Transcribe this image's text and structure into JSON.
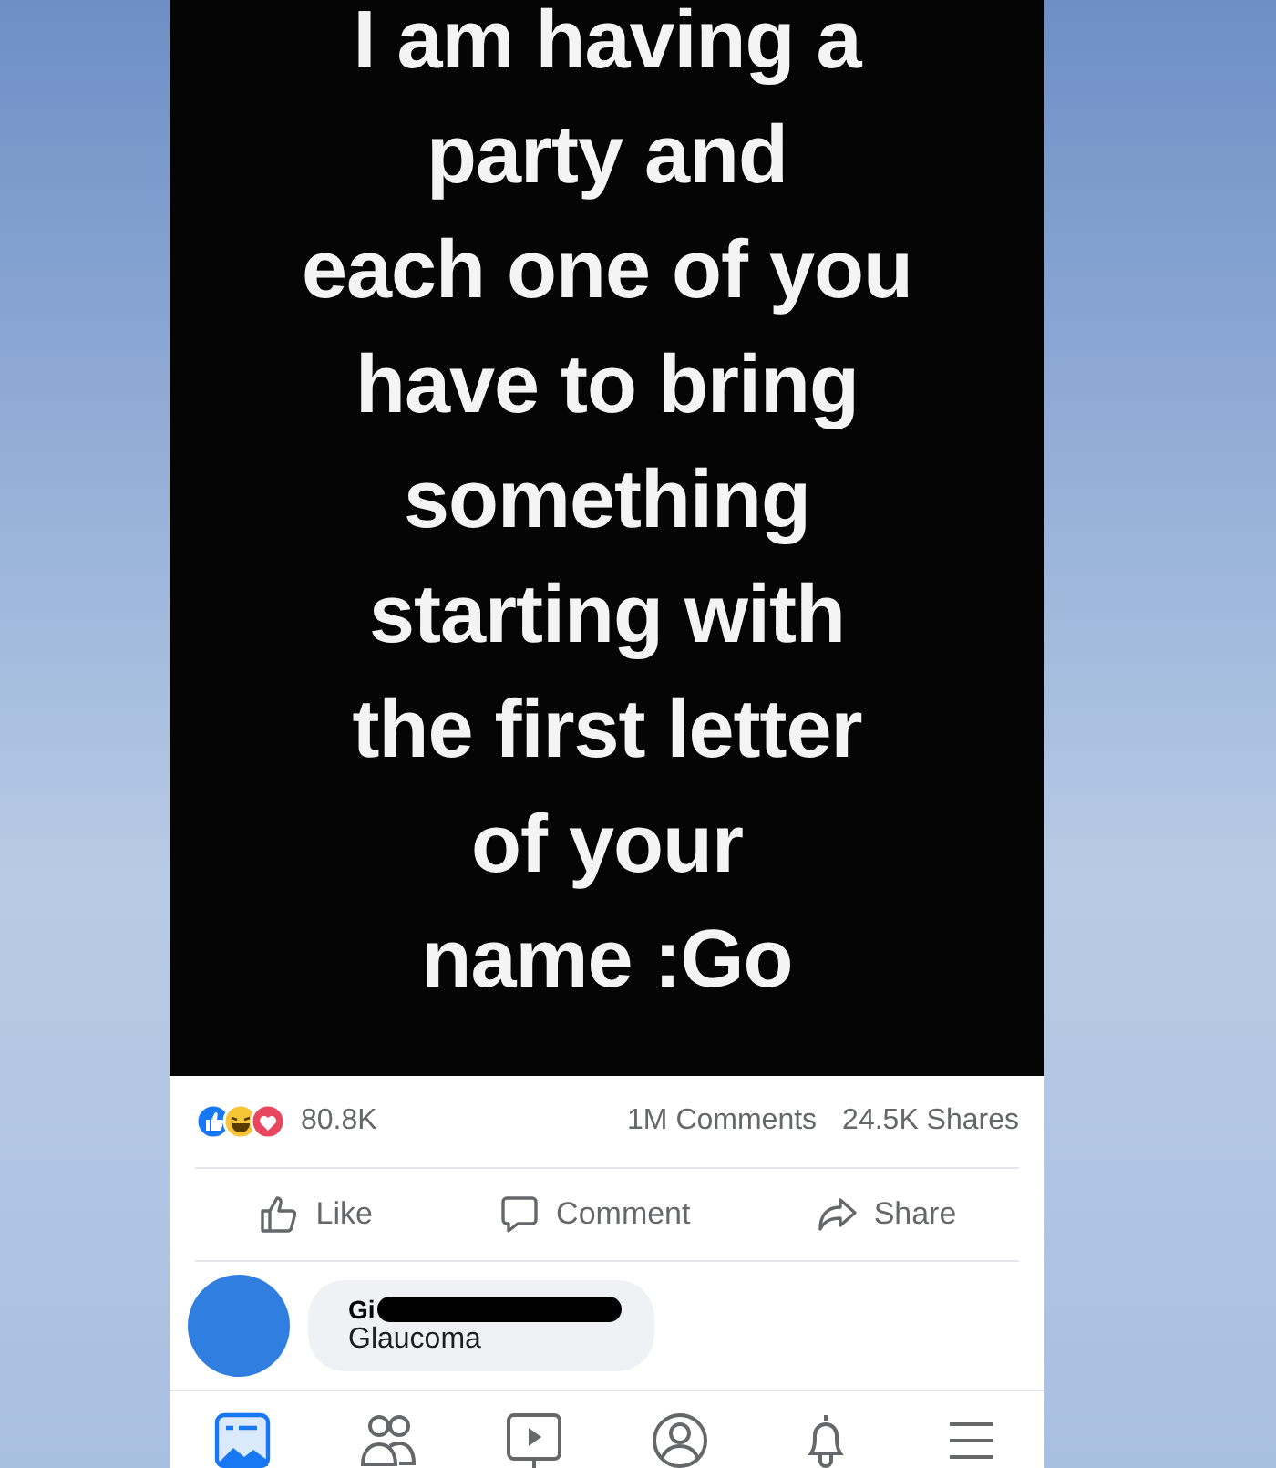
{
  "post": {
    "text": "I am having a\nparty and\neach one of you\nhave to bring\nsomething\nstarting with\nthe first letter\nof your\nname :Go"
  },
  "stats": {
    "reactions": "80.8K",
    "comments": "1M Comments",
    "shares": "24.5K Shares"
  },
  "actions": [
    {
      "kind": "like",
      "label": "Like"
    },
    {
      "kind": "comment",
      "label": "Comment"
    },
    {
      "kind": "share",
      "label": "Share"
    }
  ],
  "comment": {
    "author": "Gi",
    "redacted": true,
    "text": "Glaucoma"
  },
  "nav": [
    {
      "kind": "feed",
      "selected": true
    },
    {
      "kind": "friends",
      "selected": false
    },
    {
      "kind": "watch",
      "selected": false
    },
    {
      "kind": "profile",
      "selected": false
    },
    {
      "kind": "notifications",
      "selected": false
    },
    {
      "kind": "menu",
      "selected": false
    }
  ]
}
